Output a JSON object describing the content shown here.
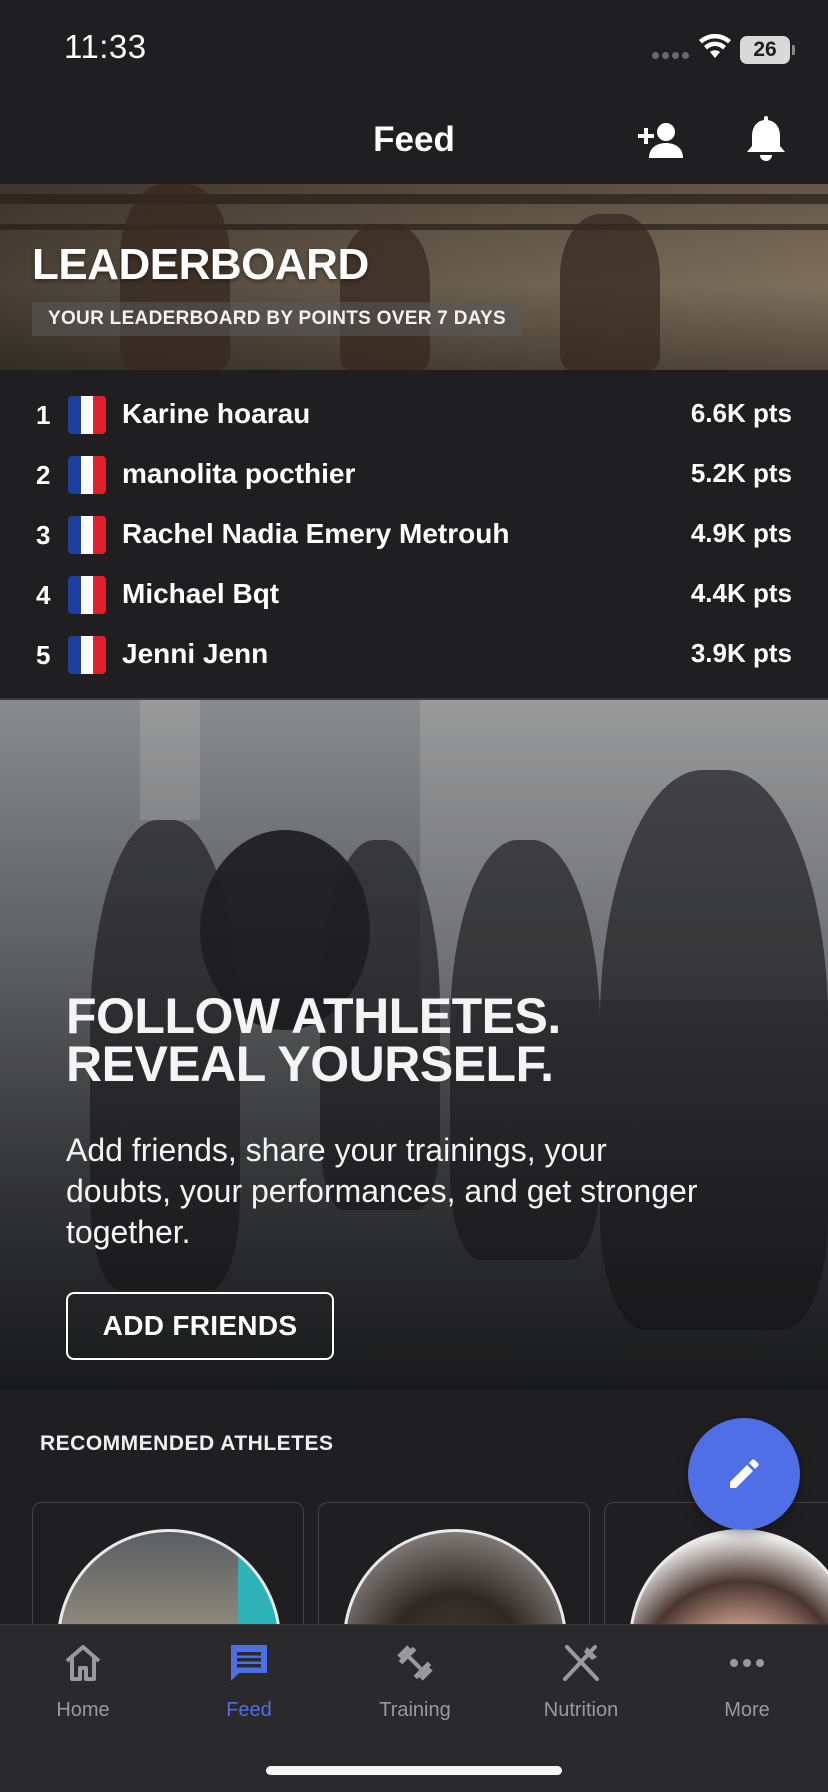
{
  "status_bar": {
    "time": "11:33",
    "battery": "26"
  },
  "header": {
    "title": "Feed",
    "add_user_icon": "add-user-icon",
    "bell_icon": "bell-icon"
  },
  "leaderboard": {
    "title": "LEADERBOARD",
    "subtitle": "YOUR LEADERBOARD BY POINTS OVER 7 DAYS",
    "flag_colors": [
      "#1f3f9e",
      "#ffffff",
      "#e0202a"
    ],
    "entries": [
      {
        "rank": "1",
        "name": "Karine hoarau",
        "points": "6.6K pts"
      },
      {
        "rank": "2",
        "name": "manolita pocthier",
        "points": "5.2K pts"
      },
      {
        "rank": "3",
        "name": "Rachel Nadia Emery Metrouh",
        "points": "4.9K pts"
      },
      {
        "rank": "4",
        "name": "Michael Bqt",
        "points": "4.4K pts"
      },
      {
        "rank": "5",
        "name": "Jenni Jenn",
        "points": "3.9K pts"
      }
    ]
  },
  "promo": {
    "headline_line1": "FOLLOW ATHLETES.",
    "headline_line2": "REVEAL YOURSELF.",
    "body": "Add friends, share your trainings, your doubts, your performances, and get stronger together.",
    "button_label": "ADD FRIENDS"
  },
  "recommended": {
    "title": "RECOMMENDED ATHLETES"
  },
  "fab": {
    "icon": "pencil-icon",
    "color": "#4f6fe6"
  },
  "tab_bar": {
    "active_color": "#4f6fe6",
    "tabs": [
      {
        "label": "Home",
        "icon": "home-icon"
      },
      {
        "label": "Feed",
        "icon": "feed-icon"
      },
      {
        "label": "Training",
        "icon": "dumbbell-icon"
      },
      {
        "label": "Nutrition",
        "icon": "fork-knife-icon"
      },
      {
        "label": "More",
        "icon": "more-icon"
      }
    ]
  }
}
